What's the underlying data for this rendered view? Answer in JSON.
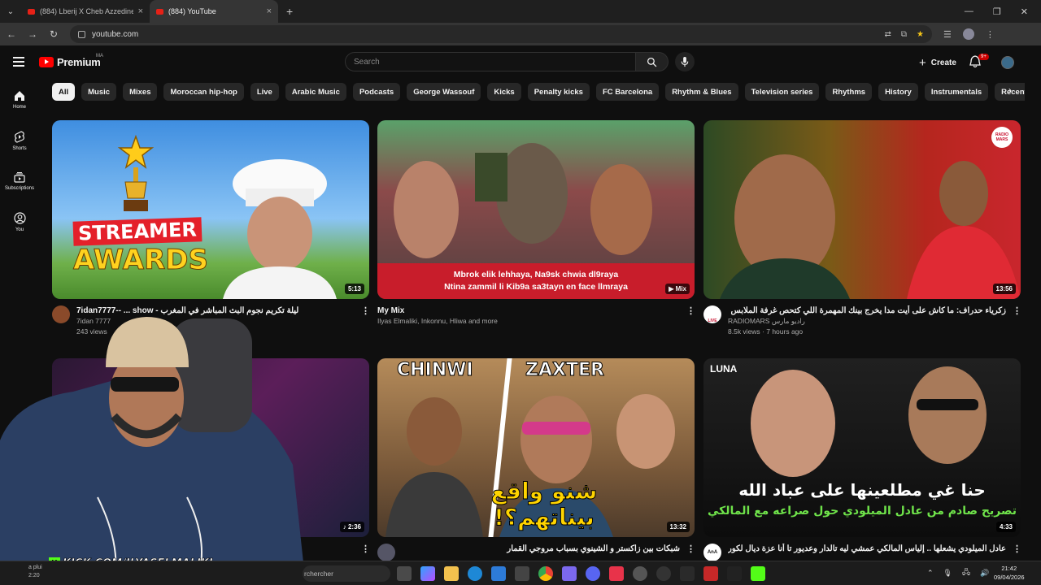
{
  "browser": {
    "tabs": [
      {
        "title": "(884) Lberij X Cheb Azzedine - ",
        "active": false
      },
      {
        "title": "(884) YouTube",
        "active": true
      }
    ],
    "url": "youtube.com"
  },
  "header": {
    "logo_text": "Premium",
    "country_code": "MA",
    "search_placeholder": "Search",
    "create_label": "Create",
    "notification_count": "9+"
  },
  "sidebar": {
    "items": [
      {
        "label": "Home",
        "icon": "home-icon"
      },
      {
        "label": "Shorts",
        "icon": "shorts-icon"
      },
      {
        "label": "Subscriptions",
        "icon": "subscriptions-icon"
      },
      {
        "label": "You",
        "icon": "you-icon"
      }
    ]
  },
  "chips": [
    "All",
    "Music",
    "Mixes",
    "Moroccan hip-hop",
    "Live",
    "Arabic Music",
    "Podcasts",
    "George Wassouf",
    "Kicks",
    "Penalty kicks",
    "FC Barcelona",
    "Rhythm & Blues",
    "Television series",
    "Rhythms",
    "History",
    "Instrumentals",
    "Recently uploaded"
  ],
  "videos": [
    {
      "title": "7idan7777-- ... show - ليلة تكريم نجوم البث المباشر في المغرب",
      "channel": "7idan 7777",
      "stats": "243 views",
      "duration": "5:13",
      "thumb_text_1": "STREAMER",
      "thumb_text_2": "AWARDS"
    },
    {
      "title": "My Mix",
      "channel": "Ilyas Elmaliki, Inkonnu, Hliwa and more",
      "stats": "",
      "duration": "Mix",
      "banner_line_1": "Mbrok elik lehhaya, Na9sk chwia dl9raya",
      "banner_line_2": "Ntina zammil li Kib9a sa3tayn en face llmraya"
    },
    {
      "title": "زكرياء حدراف: ما كاش على أيت مدا يخرج بينك المهمرة اللي كتحص غرفة الملابس",
      "channel": "RADIOMARS راديو مارس",
      "stats": "8.5k views · 7 hours ago",
      "duration": "13:56",
      "badge": "RADIO MARS",
      "avatar_tag": "LIVE"
    },
    {
      "title": "",
      "channel": "",
      "stats": "",
      "duration": "2:36"
    },
    {
      "title": "شبكات بين زاكستر و الشينوي بسباب مروجي القمار",
      "channel": "",
      "stats": "",
      "duration": "13:32",
      "name_left": "CHINWI",
      "name_right": "ZAXTER",
      "thumb_arabic": "شنو واقع بيناتهم؟!"
    },
    {
      "title": "عادل الميلودي يشعلها .. إلياس المالكي عمشي ليه تالدار وعديور تا أنا عزة ديال لكورة ورامي",
      "channel": "",
      "stats": "",
      "duration": "4:33",
      "thumb_line_1": "حنا غي مطلعينها على عباد الله",
      "thumb_line_2": "تصريح صادم من عادل الميلودي حول صراعه مع المالكي",
      "corner_logo": "LUNA",
      "avatar_text": "AnA"
    }
  ],
  "overlay": {
    "kick_text": "KICK.COM/ILYASELMALIKI"
  },
  "taskbar": {
    "search_text": "rchercher",
    "time": "21:42",
    "date": "09/04/2026",
    "ghost_line_1": "a plui",
    "ghost_line_2": "2:20"
  }
}
